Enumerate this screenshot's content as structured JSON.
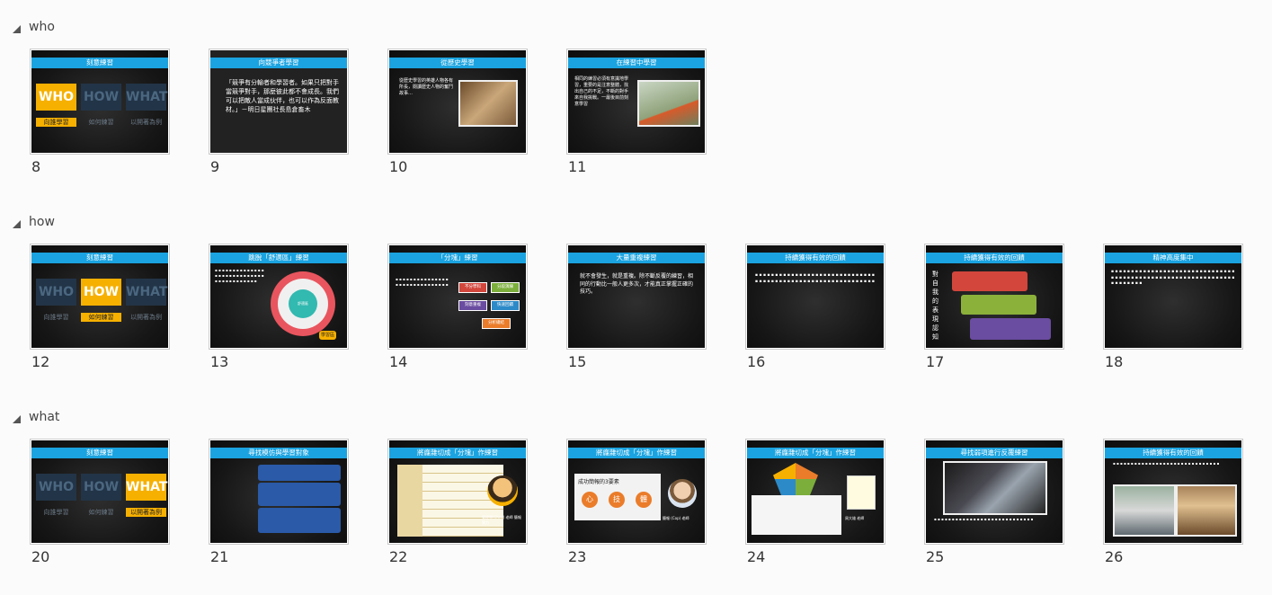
{
  "sections": [
    {
      "title": "who",
      "slides": [
        {
          "num": "8",
          "header": "刻意練習"
        },
        {
          "num": "9",
          "header": "向競爭者學習"
        },
        {
          "num": "10",
          "header": "從歷史學習"
        },
        {
          "num": "11",
          "header": "在練習中學習"
        }
      ]
    },
    {
      "title": "how",
      "slides": [
        {
          "num": "12",
          "header": "刻意練習"
        },
        {
          "num": "13",
          "header": "跳脫「舒適區」練習"
        },
        {
          "num": "14",
          "header": "「分塊」練習"
        },
        {
          "num": "15",
          "header": "大量重複練習"
        },
        {
          "num": "16",
          "header": "持續獲得有效的回饋"
        },
        {
          "num": "17",
          "header": "持續獲得有效的回饋"
        },
        {
          "num": "18",
          "header": "精神高度集中"
        }
      ]
    },
    {
      "title": "what",
      "slides": [
        {
          "num": "20",
          "header": "刻意練習"
        },
        {
          "num": "21",
          "header": "尋找模仿與學習對象"
        },
        {
          "num": "22",
          "header": "將龐雜切成「分塊」作練習"
        },
        {
          "num": "23",
          "header": "將龐雜切成「分塊」作練習"
        },
        {
          "num": "24",
          "header": "將龐雜切成「分塊」作練習"
        },
        {
          "num": "25",
          "header": "尋找弱項進行反覆練習"
        },
        {
          "num": "26",
          "header": "持續獲得有效的回饋"
        }
      ]
    }
  ],
  "www": {
    "who": "WHO",
    "how": "HOW",
    "what": "WHAT",
    "who_sub": "向誰學習",
    "how_sub": "如何練習",
    "what_sub": "以開著為例"
  },
  "slide_text": {
    "s9": "「競爭有分輸者和學習者。如果只把對手當競爭對手，那麼彼此都不會成長。我們可以把敵人當成伙伴，也可以作為反面教材。」－明日星團社長島倉畜木",
    "s10": "從歷史學習的英雄人物各有所長，閱讀歷史人物的奮鬥故事…",
    "s11": "相同的練習必須有意識地學習，重要的是注意整體，找出自己的不足，不斷的對手來自我挑戰。一最後目前刻意學習",
    "s13_inner": "舒適區",
    "s13_mid": "學習區",
    "s13_outer": "恐慌區",
    "s14_box1": "不分學科",
    "s14_box2": "分段演練",
    "s14_box3": "刻意重複",
    "s14_box4": "快速回饋",
    "s14_box5": "分析總結",
    "s15": "就不會發生，就是重複。除不斷反覆的練習，相同的行動比一般人更多次，才能真正掌握正確的技巧。",
    "s17_vert": "對自我的表現認知",
    "s22_title": "管理學(Chris) 老師 簡報實力",
    "s23_title": "成功簡報的3要素",
    "s23_c1": "心",
    "s23_c2": "技",
    "s23_c3": "體",
    "s23_person": "簡報 (Cop) 老師",
    "s24_person": "周大雄 老師"
  },
  "colors": {
    "accent_bar": "#1aa3e0",
    "highlight": "#f6b000",
    "slide_bg": "#151515"
  }
}
